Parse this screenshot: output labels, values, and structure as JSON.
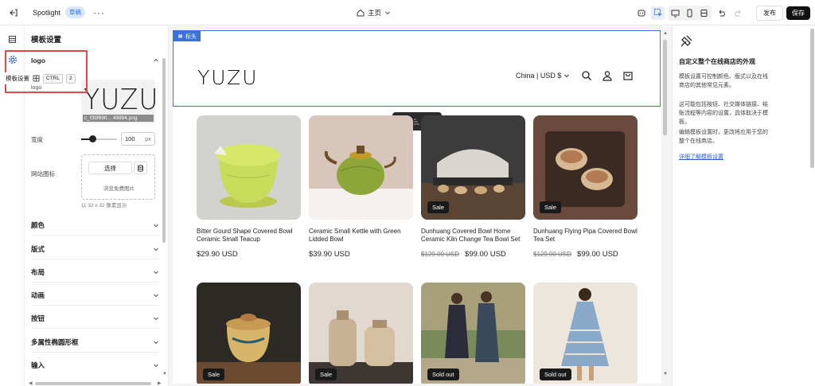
{
  "topbar": {
    "app_name": "Spotlight",
    "status_badge": "草稿",
    "page_selector": "主页",
    "publish_label": "发布",
    "save_label": "保存"
  },
  "panel": {
    "title": "模板设置",
    "logo_section": {
      "title": "logo",
      "field_label": "logo",
      "thumb_text": "YUZU",
      "file_name": "c_f35f690... 49894.png",
      "width_label": "宽度",
      "width_value": "100",
      "width_unit": "px",
      "width_fraction": 0.3,
      "favicon_label": "网站图标",
      "select_label": "选择",
      "browse_label": "浏览免费图片",
      "favicon_hint": "以 32 x 32 像素显示"
    },
    "sections": [
      "颜色",
      "版式",
      "布局",
      "动画",
      "按钮",
      "多属性椭圆形框",
      "输入"
    ]
  },
  "tooltip": {
    "label": "模板设置",
    "key1": "CTRL",
    "key2": "2"
  },
  "preview": {
    "header_tag": "标头",
    "store_logo": "YUZU",
    "locale": "China | USD $",
    "products": [
      {
        "name": "Bitter Gourd Shape Covered Bowl Ceramic Small Teacup",
        "price": "$29.90 USD",
        "old_price": "",
        "badge": ""
      },
      {
        "name": "Ceramic Small Kettle with Green Lidded Bowl",
        "price": "$39.90 USD",
        "old_price": "",
        "badge": ""
      },
      {
        "name": "Dunhuang Covered Bowl Home Ceramic Kiln Change Tea Bowl Set",
        "price": "$99.00 USD",
        "old_price": "$129.00 USD",
        "badge": "Sale"
      },
      {
        "name": "Dunhuang Flying Pipa Covered Bowl Tea Set",
        "price": "$99.00 USD",
        "old_price": "$129.00 USD",
        "badge": "Sale"
      },
      {
        "name": "",
        "price": "",
        "old_price": "",
        "badge": "Sale"
      },
      {
        "name": "",
        "price": "",
        "old_price": "",
        "badge": "Sale"
      },
      {
        "name": "",
        "price": "",
        "old_price": "",
        "badge": "Sold out"
      },
      {
        "name": "",
        "price": "",
        "old_price": "",
        "badge": "Sold out"
      }
    ]
  },
  "help": {
    "title": "自定义整个在线商店的外观",
    "p1": "模板设置可控制颜色、版式以及在线商店的其他常见元素。",
    "p2": "这可能包括按钮、社交媒体链接、结账流程等内容的设置，具体取决于模板。",
    "p3": "编辑模板设置时，更改将应用于您的整个在线商店。",
    "link": "详细了解模板设置"
  }
}
